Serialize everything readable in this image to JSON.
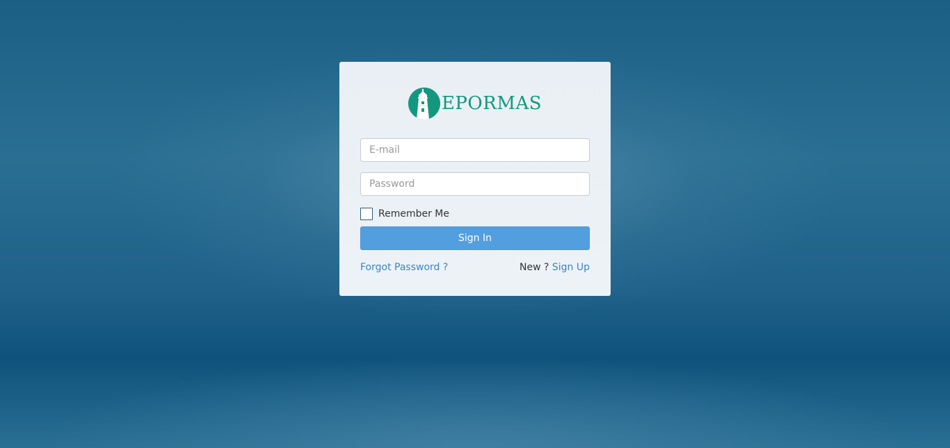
{
  "brand": {
    "name": "EPORMAS",
    "primary_color": "#14977f",
    "logo_icon": "lighthouse-icon"
  },
  "form": {
    "email_placeholder": "E-mail",
    "password_placeholder": "Password",
    "remember_label": "Remember Me",
    "remember_checked": false,
    "signin_label": "Sign In",
    "forgot_label": "Forgot Password ?",
    "new_label": "New ?",
    "signup_label": "Sign Up"
  },
  "colors": {
    "button": "#529fe0",
    "link": "#3a86c7",
    "background": "#1f6189"
  }
}
